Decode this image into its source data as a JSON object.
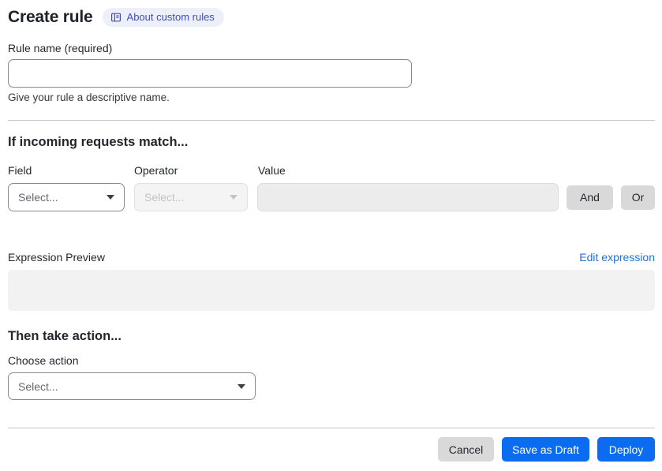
{
  "page": {
    "title": "Create rule",
    "about_badge_label": "About custom rules"
  },
  "rule_name": {
    "label": "Rule name (required)",
    "value": "",
    "helper": "Give your rule a descriptive name."
  },
  "match_section": {
    "heading": "If incoming requests match...",
    "field_label": "Field",
    "operator_label": "Operator",
    "value_label": "Value",
    "field_placeholder": "Select...",
    "operator_placeholder": "Select...",
    "value_value": "",
    "and_button": "And",
    "or_button": "Or",
    "expression_preview_label": "Expression Preview",
    "edit_expression_link": "Edit expression",
    "expression_value": ""
  },
  "action_section": {
    "heading": "Then take action...",
    "choose_action_label": "Choose action",
    "action_placeholder": "Select..."
  },
  "footer": {
    "cancel": "Cancel",
    "save_as_draft": "Save as Draft",
    "deploy": "Deploy"
  },
  "colors": {
    "primary_blue": "#0b6cf2",
    "link_blue": "#2270dd",
    "badge_bg": "#eef0f9",
    "badge_text": "#3e4cc0",
    "button_gray": "#d9d9d9",
    "disabled_bg": "#f4f4f4",
    "preview_bg": "#f2f2f2"
  }
}
